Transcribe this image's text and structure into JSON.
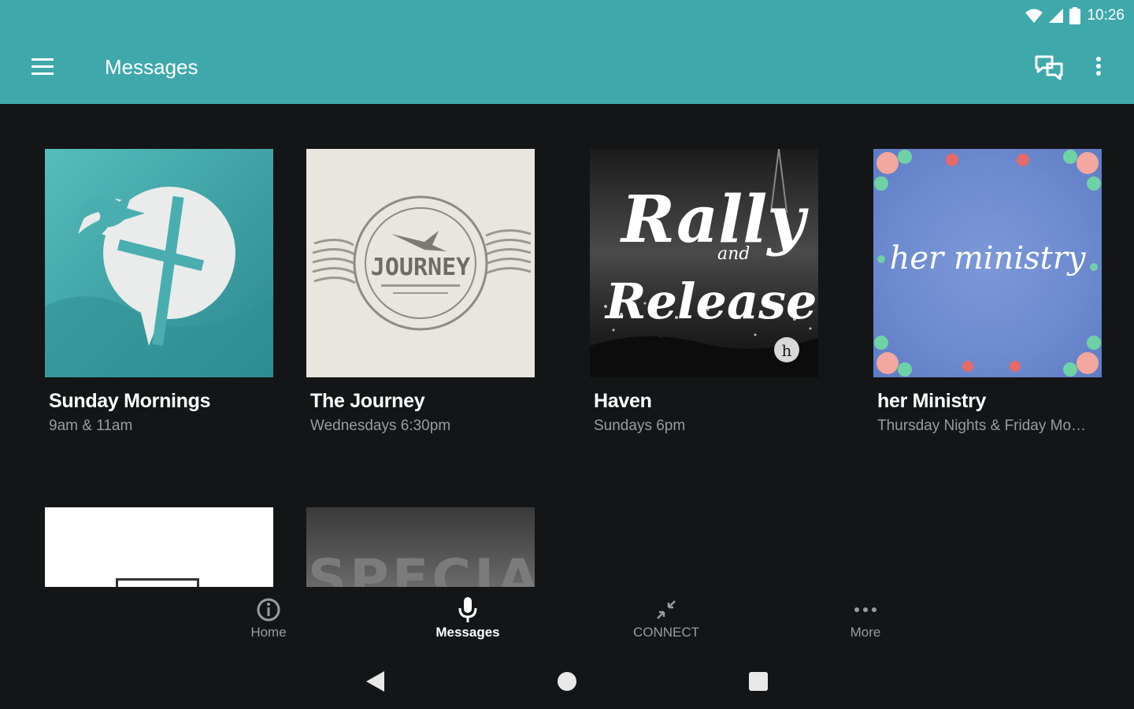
{
  "status_bar": {
    "time": "10:26"
  },
  "app_bar": {
    "title": "Messages",
    "menu_icon": "hamburger-menu-icon",
    "chat_icon": "chat-bubbles-icon",
    "overflow_icon": "more-vert-icon",
    "color": "#3fa8ab"
  },
  "series": [
    {
      "title": "Sunday Mornings",
      "subtitle": "9am & 11am",
      "art_icon": "dove-cross-logo"
    },
    {
      "title": "The Journey",
      "subtitle": "Wednesdays 6:30pm",
      "art_text": "JOURNEY",
      "art_icon": "postmark-stamp"
    },
    {
      "title": "Haven",
      "subtitle": "Sundays 6pm",
      "art_text_1": "Rally",
      "art_text_2": "and",
      "art_text_3": "Release"
    },
    {
      "title": "her Ministry",
      "subtitle": "Thursday Nights & Friday Mornings",
      "art_text": "her ministry"
    },
    {
      "title": "",
      "subtitle": ""
    },
    {
      "title": "",
      "subtitle": "",
      "art_text": "SPECIAL"
    }
  ],
  "bottom_nav": [
    {
      "label": "Home",
      "icon": "info-circle-icon",
      "active": false
    },
    {
      "label": "Messages",
      "icon": "microphone-icon",
      "active": true
    },
    {
      "label": "CONNECT",
      "icon": "connect-arrows-icon",
      "active": false
    },
    {
      "label": "More",
      "icon": "more-horiz-icon",
      "active": false
    }
  ],
  "system_nav": {
    "back": "back-triangle-icon",
    "home": "home-circle-icon",
    "recents": "recents-square-icon"
  }
}
